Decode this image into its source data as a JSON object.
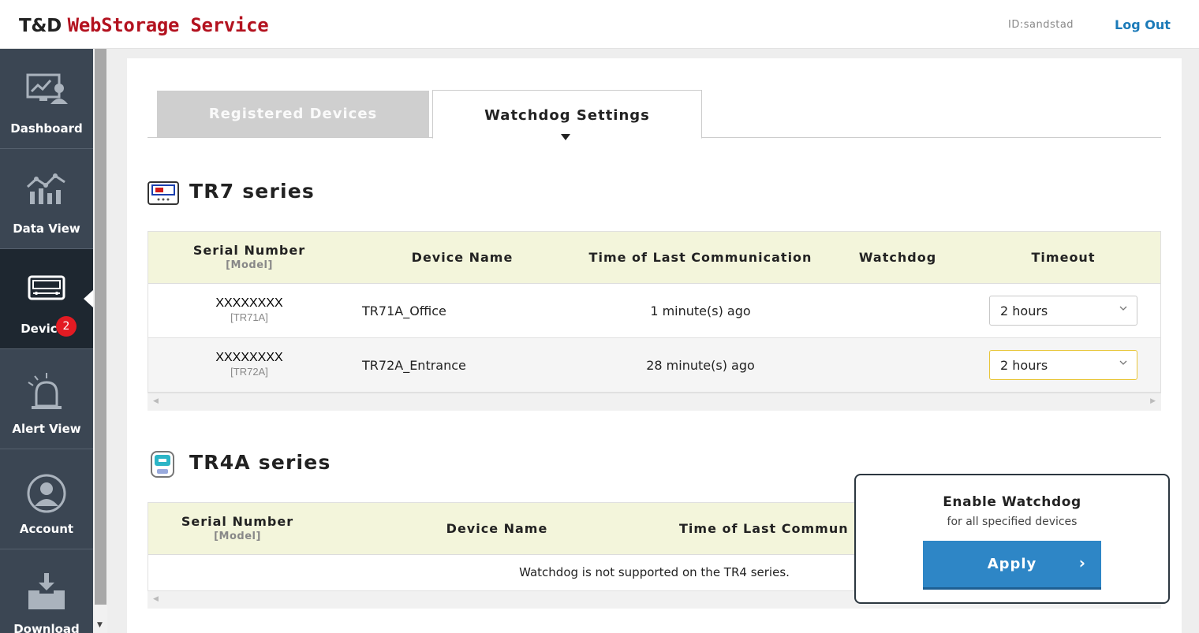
{
  "header": {
    "logo_prefix": "T&D",
    "logo_name": "WebStorage Service",
    "user_id": "ID:sandstad",
    "logout_label": "Log Out"
  },
  "sidebar": {
    "items": [
      {
        "label": "Dashboard",
        "icon": "dashboard-icon"
      },
      {
        "label": "Data View",
        "icon": "data-view-icon"
      },
      {
        "label": "Devices",
        "icon": "devices-icon",
        "active": true
      },
      {
        "label": "Alert View",
        "icon": "alert-icon",
        "badge": "2"
      },
      {
        "label": "Account",
        "icon": "account-icon"
      },
      {
        "label": "Download",
        "icon": "download-icon"
      }
    ]
  },
  "tabs": {
    "registered": "Registered Devices",
    "watchdog": "Watchdog Settings",
    "active": "watchdog"
  },
  "tr7": {
    "title": "TR7 series",
    "headers": {
      "serial": "Serial Number",
      "model": "[Model]",
      "name": "Device Name",
      "last_comm": "Time of Last Communication",
      "watchdog": "Watchdog",
      "timeout": "Timeout"
    },
    "rows": [
      {
        "serial": "XXXXXXXX",
        "model": "[TR71A]",
        "name": "TR71A_Office",
        "last_comm": "1 minute(s) ago",
        "timeout": "2 hours"
      },
      {
        "serial": "XXXXXXXX",
        "model": "[TR72A]",
        "name": "TR72A_Entrance",
        "last_comm": "28 minute(s) ago",
        "timeout": "2 hours"
      }
    ]
  },
  "tr4a": {
    "title": "TR4A series",
    "headers": {
      "serial": "Serial Number",
      "model": "[Model]",
      "name": "Device Name",
      "last_comm": "Time of Last Commun"
    },
    "empty_message": "Watchdog is not supported on the TR4 series."
  },
  "popup": {
    "title": "Enable Watchdog",
    "subtitle": "for all specified devices",
    "apply_label": "Apply"
  },
  "colors": {
    "brand_red": "#b3121f",
    "link_blue": "#1b7ab8",
    "sidebar_bg": "#3b4653",
    "sidebar_active": "#1e2730",
    "table_header_bg": "#f3f5db",
    "apply_blue": "#2e86c6",
    "badge_red": "#e31b23"
  }
}
